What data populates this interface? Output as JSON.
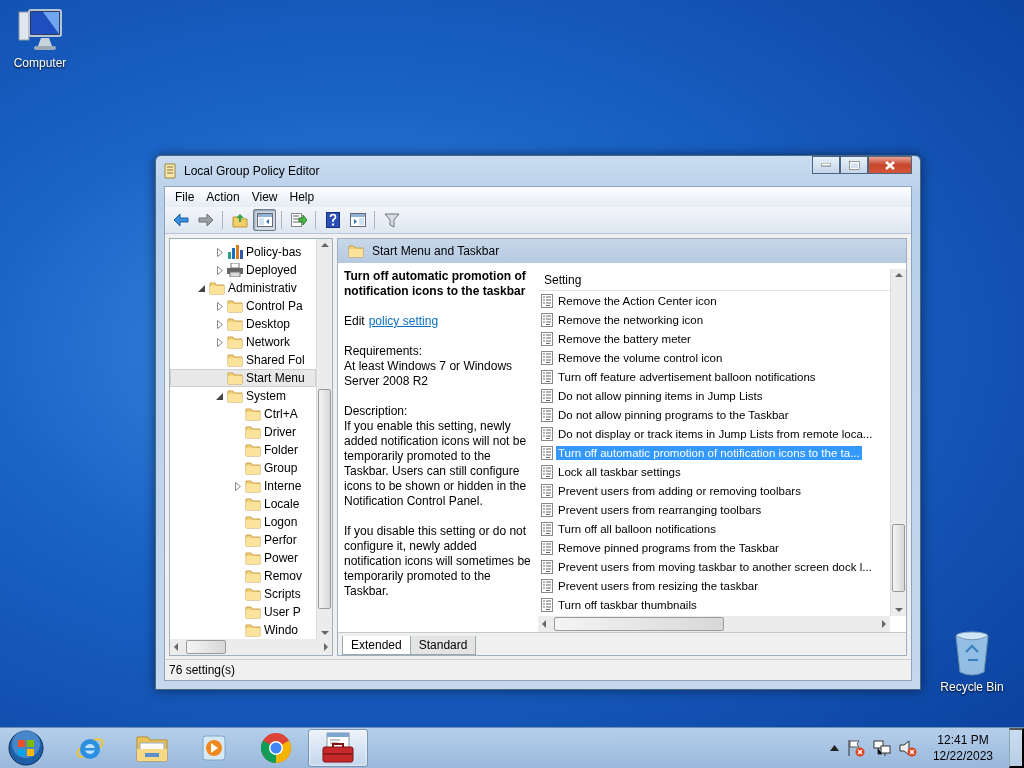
{
  "desktop_icons": [
    {
      "label": "Computer",
      "kind": "computer"
    },
    {
      "label": "Recycle Bin",
      "kind": "recycle-bin"
    }
  ],
  "window": {
    "title": "Local Group Policy Editor",
    "menu": [
      "File",
      "Action",
      "View",
      "Help"
    ],
    "toolbar": [
      {
        "kind": "back",
        "pressed": false
      },
      {
        "kind": "forward",
        "pressed": false
      },
      {
        "kind": "separator"
      },
      {
        "kind": "up",
        "pressed": false
      },
      {
        "kind": "tree-toggle",
        "pressed": true
      },
      {
        "kind": "separator"
      },
      {
        "kind": "export",
        "pressed": false
      },
      {
        "kind": "separator"
      },
      {
        "kind": "help",
        "pressed": false
      },
      {
        "kind": "action-pane",
        "pressed": false
      },
      {
        "kind": "separator"
      },
      {
        "kind": "filter",
        "pressed": false
      }
    ]
  },
  "tree": {
    "items": [
      {
        "children": [
          {
            "label": "Policy-bas",
            "kind": "chart",
            "expanded": false,
            "selected": false
          },
          {
            "label": "Deployed",
            "kind": "printer",
            "expanded": false,
            "selected": false
          }
        ]
      },
      {
        "label": "Administrativ",
        "kind": "folder",
        "expanded": true,
        "selected": false,
        "children": [
          {
            "label": "Control Pa",
            "kind": "folder",
            "expanded": false,
            "selected": false
          },
          {
            "label": "Desktop",
            "kind": "folder",
            "expanded": false,
            "selected": false
          },
          {
            "label": "Network",
            "kind": "folder",
            "expanded": false,
            "selected": false
          },
          {
            "label": "Shared Fol",
            "kind": "folder",
            "selected": false
          },
          {
            "label": "Start Menu",
            "kind": "folder",
            "selected": true
          },
          {
            "label": "System",
            "kind": "folder",
            "expanded": true,
            "selected": false,
            "children": [
              {
                "label": "Ctrl+A",
                "kind": "folder",
                "selected": false
              },
              {
                "label": "Driver",
                "kind": "folder",
                "selected": false
              },
              {
                "label": "Folder",
                "kind": "folder",
                "selected": false
              },
              {
                "label": "Group",
                "kind": "folder",
                "selected": false
              },
              {
                "label": "Interne",
                "kind": "folder",
                "expanded": false,
                "selected": false
              },
              {
                "label": "Locale",
                "kind": "folder",
                "selected": false
              },
              {
                "label": "Logon",
                "kind": "folder",
                "selected": false
              },
              {
                "label": "Perfor",
                "kind": "folder",
                "selected": false
              },
              {
                "label": "Power",
                "kind": "folder",
                "selected": false
              },
              {
                "label": "Remov",
                "kind": "folder",
                "selected": false
              },
              {
                "label": "Scripts",
                "kind": "folder",
                "selected": false
              },
              {
                "label": "User P",
                "kind": "folder",
                "selected": false
              },
              {
                "label": "Windo",
                "kind": "folder",
                "selected": false
              }
            ]
          }
        ]
      }
    ]
  },
  "header": "Start Menu and Taskbar",
  "description": {
    "title": "Turn off automatic promotion of notification icons to the taskbar",
    "edit_prefix": "Edit",
    "edit_link": "policy setting",
    "requirements_label": "Requirements:",
    "requirements": "At least Windows 7 or Windows Server 2008 R2",
    "description_label": "Description:",
    "paragraphs": [
      "If you enable this setting, newly added notification icons will not be temporarily promoted to the Taskbar. Users can still configure icons to be shown or hidden in the Notification Control Panel.",
      "If you disable this setting or do not configure it, newly added notification icons will sometimes be temporarily promoted to the Taskbar."
    ]
  },
  "table": {
    "columns": [
      "Setting"
    ],
    "rows": [
      {
        "name": "Remove the Action Center icon",
        "selected": false
      },
      {
        "name": "Remove the networking icon",
        "selected": false
      },
      {
        "name": "Remove the battery meter",
        "selected": false
      },
      {
        "name": "Remove the volume control icon",
        "selected": false
      },
      {
        "name": "Turn off feature advertisement balloon notifications",
        "selected": false
      },
      {
        "name": "Do not allow pinning items in Jump Lists",
        "selected": false
      },
      {
        "name": "Do not allow pinning programs to the Taskbar",
        "selected": false
      },
      {
        "name": "Do not display or track items in Jump Lists from remote loca...",
        "selected": false
      },
      {
        "name": "Turn off automatic promotion of notification icons to the ta...",
        "selected": true
      },
      {
        "name": "Lock all taskbar settings",
        "selected": false
      },
      {
        "name": "Prevent users from adding or removing toolbars",
        "selected": false
      },
      {
        "name": "Prevent users from rearranging toolbars",
        "selected": false
      },
      {
        "name": "Turn off all balloon notifications",
        "selected": false
      },
      {
        "name": "Remove pinned programs from the Taskbar",
        "selected": false
      },
      {
        "name": "Prevent users from moving taskbar to another screen dock l...",
        "selected": false
      },
      {
        "name": "Prevent users from resizing the taskbar",
        "selected": false
      },
      {
        "name": "Turn off taskbar thumbnails",
        "selected": false
      }
    ]
  },
  "tabs": [
    {
      "label": "Extended",
      "selected": true
    },
    {
      "label": "Standard",
      "selected": false
    }
  ],
  "status_bar": "76 setting(s)",
  "taskbar": {
    "apps": [
      {
        "kind": "ie",
        "active": false
      },
      {
        "kind": "explorer",
        "active": false
      },
      {
        "kind": "media",
        "active": false
      },
      {
        "kind": "chrome",
        "active": false
      },
      {
        "kind": "toolbox",
        "active": true
      }
    ],
    "time": "12:41 PM",
    "date": "12/22/2023"
  }
}
